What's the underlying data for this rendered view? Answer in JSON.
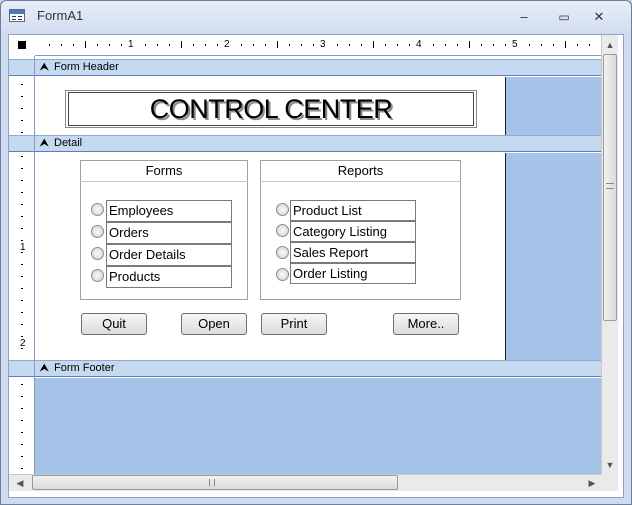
{
  "window": {
    "title": "FormA1",
    "minimize_glyph": "–",
    "maximize_glyph": "▭",
    "close_glyph": "✕"
  },
  "ruler": {
    "h_numbers": [
      "1",
      "2",
      "3",
      "4",
      "5"
    ],
    "v_numbers": [
      "1",
      "2"
    ]
  },
  "sections": {
    "header": "Form Header",
    "detail": "Detail",
    "footer": "Form Footer"
  },
  "header_title": "CONTROL CENTER",
  "forms_group": {
    "caption": "Forms",
    "options": [
      "Employees",
      "Orders",
      "Order Details",
      "Products"
    ]
  },
  "reports_group": {
    "caption": "Reports",
    "options": [
      "Product List",
      "Category Listing",
      "Sales Report",
      "Order Listing"
    ]
  },
  "buttons": {
    "quit": "Quit",
    "open": "Open",
    "print": "Print",
    "more": "More.."
  },
  "icons": {
    "section_chevron": "chevron-up-double-icon",
    "app": "form-icon"
  },
  "colors": {
    "section_bar": "#c5d9f1",
    "canvas_blue": "#a5c3e9"
  }
}
